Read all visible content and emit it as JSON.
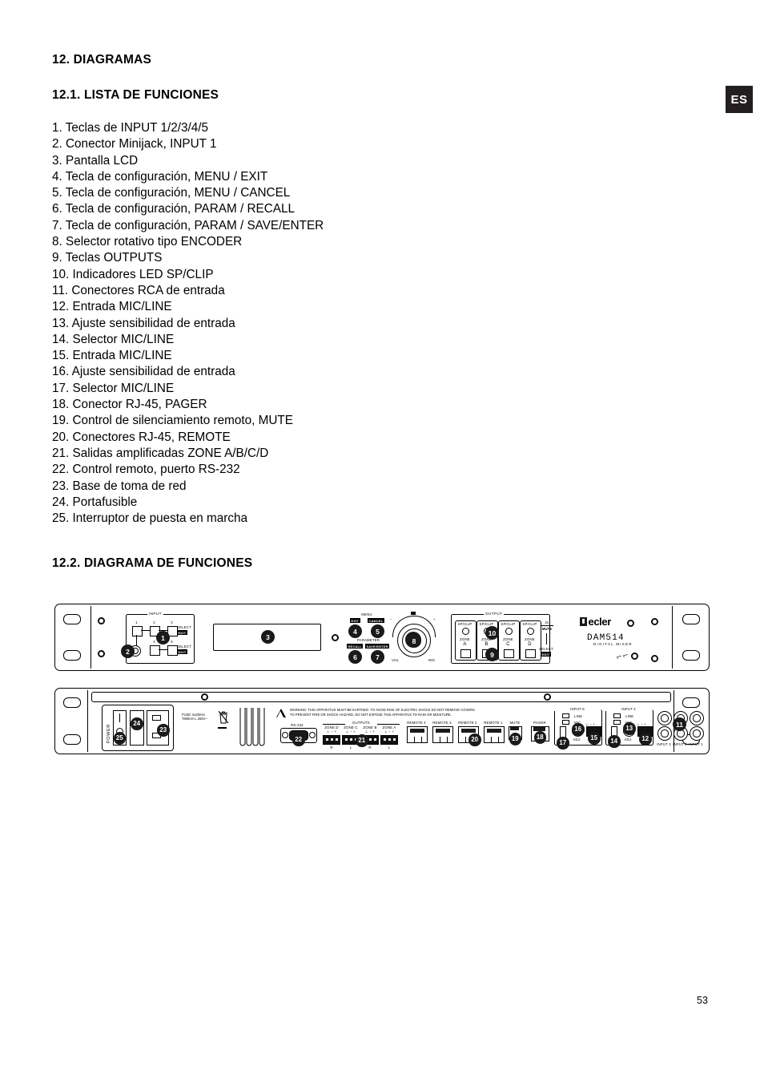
{
  "document": {
    "language_badge": "ES",
    "page_number": "53",
    "section_title": "12. DIAGRAMAS",
    "subsection_1_title": "12.1. LISTA DE FUNCIONES",
    "subsection_2_title": "12.2. DIAGRAMA DE FUNCIONES"
  },
  "function_list": [
    "1. Teclas de INPUT 1/2/3/4/5",
    "2. Conector Minijack, INPUT 1",
    "3. Pantalla LCD",
    "4. Tecla de configuración, MENU / EXIT",
    "5. Tecla de configuración, MENU / CANCEL",
    "6. Tecla de configuración, PARAM / RECALL",
    "7. Tecla de configuración, PARAM / SAVE/ENTER",
    "8. Selector rotativo tipo ENCODER",
    "9. Teclas OUTPUTS",
    "10. Indicadores LED SP/CLIP",
    "11. Conectores RCA de entrada",
    "12. Entrada MIC/LINE",
    "13. Ajuste sensibilidad de entrada",
    "14. Selector MIC/LINE",
    "15. Entrada MIC/LINE",
    "16. Ajuste sensibilidad de entrada",
    "17. Selector MIC/LINE",
    "18. Conector RJ-45, PAGER",
    "19. Control de silenciamiento remoto, MUTE",
    "20. Conectores RJ-45, REMOTE",
    "21. Salidas amplificadas ZONE A/B/C/D",
    "22. Control remoto, puerto RS-232",
    "23. Base de toma de red",
    "24. Portafusible",
    "25. Interruptor de puesta en marcha"
  ],
  "front_panel": {
    "input_group_title": "INPUT",
    "input_buttons": [
      "1",
      "2",
      "3",
      "4",
      "5"
    ],
    "select_label": "SELECT",
    "edit_label": "EDIT",
    "menu_title": "MENU",
    "menu_exit": "EXIT",
    "menu_cancel": "CANCEL",
    "parameter_title": "PARAMETER",
    "param_recall": "RECALL",
    "param_save_enter": "SAVE/ENTER",
    "encoder_vol": "VOL",
    "encoder_mix": "MIX",
    "encoder_minus": "−",
    "encoder_plus": "+",
    "output_group_title": "OUTPUT",
    "spclip_label": "SP/CLIP",
    "zone_label": "ZONE",
    "zones": [
      "A",
      "B",
      "C",
      "D"
    ],
    "mute_label": "MUTE",
    "mute_sub": "2s",
    "brand": "ecler",
    "model": "DAM514",
    "model_sub": "DIGITAL MIXER",
    "callouts": [
      "1",
      "2",
      "3",
      "4",
      "5",
      "6",
      "7",
      "8",
      "9",
      "10"
    ]
  },
  "rear_panel": {
    "power_label": "POWER",
    "fuse_line1": "FUSE: 5x20mm",
    "fuse_line2": "T800mA L 250V~",
    "warning_line1": "WARNING:  THIS APPARATUS MUST BE EARTHED.   TO AVOID RISK OF ELECTRIC SHOCK DO NOT REMOVE COVERS.",
    "warning_line2": "TO PREVENT FIRE OR SHOCK HAZARD, DO NOT EXPOSE THIS APPARATUS TO RAIN OR MOISTURE.",
    "rs232_label": "RS-232",
    "outputs_title": "OUTPUTS",
    "output_zones": [
      "ZONE D",
      "ZONE C",
      "ZONE B",
      "ZONE A"
    ],
    "terminal_marks": "⊥  −  +",
    "channel_marks": [
      "R",
      "L",
      "R",
      "L"
    ],
    "remotes": [
      "REMOTE 4",
      "REMOTE 3",
      "REMOTE 2",
      "REMOTE 1"
    ],
    "mute_label": "MUTE",
    "pager_label": "PAGER",
    "input5_title": "INPUT 5",
    "input4_title": "INPUT 4",
    "line_label": "LINE",
    "mic_label": "MIC",
    "adj_label": "ADJ.",
    "adj_min": "0",
    "adj_max": "10",
    "rca_labels": [
      "INPUT 3",
      "INPUT 2",
      "INPUT 1"
    ],
    "callouts": [
      "11",
      "12",
      "13",
      "14",
      "15",
      "16",
      "17",
      "18",
      "19",
      "20",
      "21",
      "22",
      "23",
      "24",
      "25"
    ]
  }
}
